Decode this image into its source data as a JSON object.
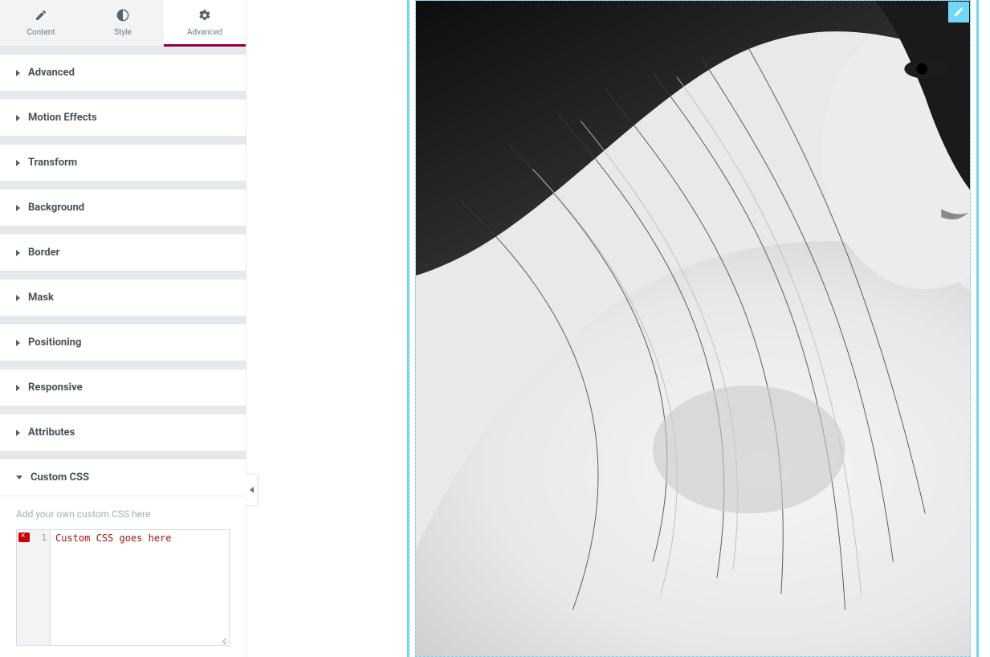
{
  "tabs": {
    "content": "Content",
    "style": "Style",
    "advanced": "Advanced",
    "active": "advanced"
  },
  "sections": [
    {
      "key": "advanced",
      "label": "Advanced",
      "open": false
    },
    {
      "key": "motion_effects",
      "label": "Motion Effects",
      "open": false
    },
    {
      "key": "transform",
      "label": "Transform",
      "open": false
    },
    {
      "key": "background",
      "label": "Background",
      "open": false
    },
    {
      "key": "border",
      "label": "Border",
      "open": false
    },
    {
      "key": "mask",
      "label": "Mask",
      "open": false
    },
    {
      "key": "positioning",
      "label": "Positioning",
      "open": false
    },
    {
      "key": "responsive",
      "label": "Responsive",
      "open": false
    },
    {
      "key": "attributes",
      "label": "Attributes",
      "open": false
    },
    {
      "key": "custom_css",
      "label": "Custom CSS",
      "open": true
    }
  ],
  "custom_css": {
    "helper": "Add your own custom CSS here",
    "line_number": "1",
    "placeholder": "Custom CSS goes here",
    "value": "Custom CSS goes here",
    "has_error": true
  },
  "icons": {
    "content": "pencil-icon",
    "style": "contrast-icon",
    "advanced": "gear-icon",
    "edit_handle": "pencil-icon",
    "caret_right": "caret-right-icon",
    "caret_down": "caret-down-icon",
    "chevron_left": "chevron-left-icon",
    "error": "error-icon"
  },
  "canvas": {
    "selected_element": "image-widget",
    "image_description": "Black-and-white portrait photograph of a woman looking to the right, hair falling across shoulder"
  },
  "colors": {
    "accent": "#93003c",
    "selection": "#71d7f7"
  }
}
